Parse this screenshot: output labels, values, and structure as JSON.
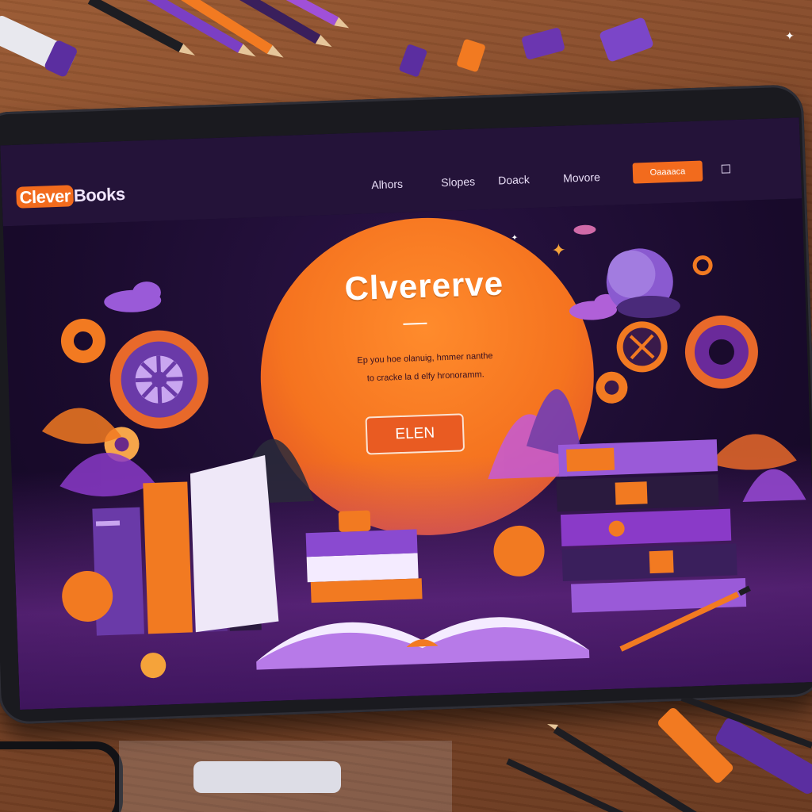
{
  "app": {
    "logo": {
      "part1": "Clever",
      "part2": "Books"
    }
  },
  "nav": {
    "links": [
      "Alhors",
      "Slopes",
      "Doack",
      "Movore"
    ],
    "button_label": "Oaaaaca"
  },
  "hero": {
    "title": "Clvererve",
    "text_line1": "Ep you hoe olanuig, hmmer nanthe",
    "text_line2": "to cracke la d elfy hronoramm.",
    "button_label": "ELEN"
  },
  "colors": {
    "accent": "#f26b1d",
    "purple": "#7b3fc4",
    "nav_bg": "#241339",
    "screen_bg": "#150a2a"
  },
  "icons": [
    "gear-icon",
    "star-icon",
    "cloud-icon",
    "planet-icon",
    "book-icon",
    "apple-icon",
    "leaf-icon",
    "pencil-icon"
  ]
}
